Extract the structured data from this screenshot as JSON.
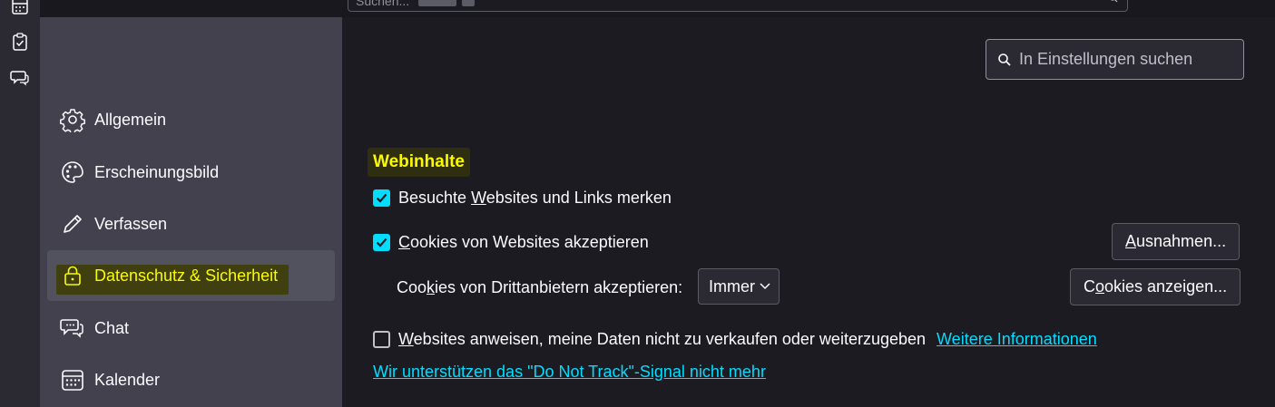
{
  "spaces_bar": {
    "icons": [
      "calendar-icon",
      "tasks-icon",
      "chat-icon"
    ]
  },
  "top_search": {
    "placeholder": "Suchen..."
  },
  "sidebar": {
    "items": [
      {
        "label": "Allgemein",
        "icon": "gear-icon"
      },
      {
        "label": "Erscheinungsbild",
        "icon": "palette-icon"
      },
      {
        "label": "Verfassen",
        "icon": "pencil-icon"
      },
      {
        "label": "Datenschutz & Sicherheit",
        "icon": "lock-icon",
        "selected": true
      },
      {
        "label": "Chat",
        "icon": "chat-bubbles-icon"
      },
      {
        "label": "Kalender",
        "icon": "calendar-icon"
      }
    ]
  },
  "settings_search": {
    "placeholder": "In Einstellungen suchen"
  },
  "webinhalte": {
    "title": "Webinhalte",
    "remember_visited": {
      "pre": "Besuchte ",
      "accel": "W",
      "post": "ebsites und Links merken",
      "checked": true
    },
    "accept_cookies": {
      "pre": "",
      "accel": "C",
      "post": "ookies von Websites akzeptieren",
      "checked": true
    },
    "exceptions_button": {
      "pre": "",
      "accel": "A",
      "post": "usnahmen..."
    },
    "third_party_label": {
      "pre": "Coo",
      "accel": "k",
      "post": "ies von Drittanbietern akzeptieren:"
    },
    "third_party_select": "Immer",
    "show_cookies_button": {
      "pre": "C",
      "accel": "o",
      "post": "okies anzeigen..."
    },
    "do_not_sell": {
      "pre": "",
      "accel": "W",
      "post": "ebsites anweisen, meine Daten nicht zu verkaufen oder weiterzugeben",
      "checked": false
    },
    "more_info_link": "Weitere Informationen",
    "dnt_link": "Wir unterstützen das \"Do Not Track\"-Signal nicht mehr"
  },
  "colors": {
    "accent": "#00ddff",
    "highlight": "#fbfb00",
    "sidebar_bg": "#42414d",
    "page_bg": "#1c1b22"
  }
}
